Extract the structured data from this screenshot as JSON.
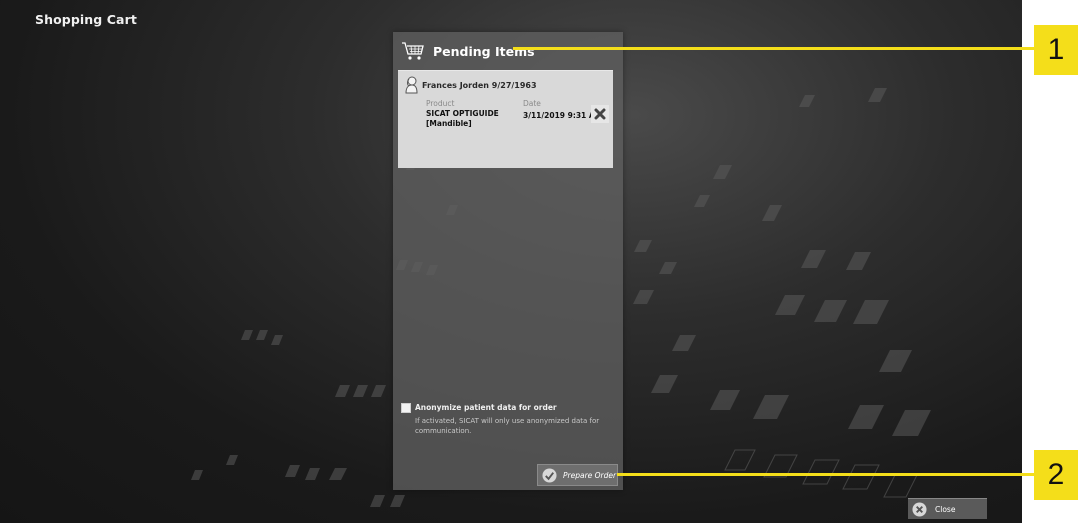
{
  "window": {
    "title": "Shopping Cart"
  },
  "panel": {
    "title": "Pending Items",
    "icon": "shopping-cart-icon",
    "item": {
      "patient_name": "Frances Jorden 9/27/1963",
      "product_label": "Product",
      "product_line1": "SICAT OPTIGUIDE",
      "product_line2": "[Mandible]",
      "date_label": "Date",
      "date_value": "3/11/2019 9:31 AM",
      "remove_icon": "close-x-icon"
    },
    "anonymize": {
      "label": "Anonymize patient data for order",
      "checked": false,
      "description": "If activated, SICAT will only use anonymized data for communication."
    },
    "prepare_button": {
      "label": "Prepare Order",
      "icon": "checkmark-icon"
    }
  },
  "close_button": {
    "label": "Close",
    "icon": "close-circle-icon"
  },
  "callouts": [
    {
      "number": "1",
      "target": "Pending Items"
    },
    {
      "number": "2",
      "target": "Prepare Order"
    }
  ],
  "colors": {
    "callout": "#f4de1a",
    "panel": "#5f5f5f",
    "card": "#d9d9d9",
    "background": "#1c1c1c"
  }
}
